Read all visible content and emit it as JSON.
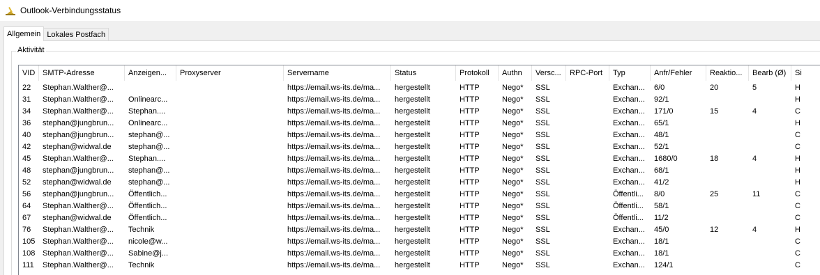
{
  "window": {
    "title": "Outlook-Verbindungsstatus"
  },
  "tabs": [
    {
      "label": "Allgemein",
      "active": true
    },
    {
      "label": "Lokales Postfach",
      "active": false
    }
  ],
  "group": {
    "label": "Aktivität"
  },
  "columns": [
    "VID",
    "SMTP-Adresse",
    "Anzeigen...",
    "Proxyserver",
    "Servername",
    "Status",
    "Protokoll",
    "Authn",
    "Versc...",
    "RPC-Port",
    "Typ",
    "Anfr/Fehler",
    "Reaktio...",
    "Bearb (Ø)",
    "Si"
  ],
  "rows": [
    [
      "22",
      "Stephan.Walther@...",
      "",
      "",
      "https://email.ws-its.de/ma...",
      "hergestellt",
      "HTTP",
      "Nego*",
      "SSL",
      "",
      "Exchan...",
      "6/0",
      "20",
      "5",
      "H"
    ],
    [
      "31",
      "Stephan.Walther@...",
      "Onlinearc...",
      "",
      "https://email.ws-its.de/ma...",
      "hergestellt",
      "HTTP",
      "Nego*",
      "SSL",
      "",
      "Exchan...",
      "92/1",
      "",
      "",
      "H"
    ],
    [
      "34",
      "Stephan.Walther@...",
      "Stephan....",
      "",
      "https://email.ws-its.de/ma...",
      "hergestellt",
      "HTTP",
      "Nego*",
      "SSL",
      "",
      "Exchan...",
      "171/0",
      "15",
      "4",
      "C"
    ],
    [
      "36",
      "stephan@jungbrun...",
      "Onlinearc...",
      "",
      "https://email.ws-its.de/ma...",
      "hergestellt",
      "HTTP",
      "Nego*",
      "SSL",
      "",
      "Exchan...",
      "65/1",
      "",
      "",
      "H"
    ],
    [
      "40",
      "stephan@jungbrun...",
      "stephan@...",
      "",
      "https://email.ws-its.de/ma...",
      "hergestellt",
      "HTTP",
      "Nego*",
      "SSL",
      "",
      "Exchan...",
      "48/1",
      "",
      "",
      "C"
    ],
    [
      "42",
      "stephan@widwal.de",
      "stephan@...",
      "",
      "https://email.ws-its.de/ma...",
      "hergestellt",
      "HTTP",
      "Nego*",
      "SSL",
      "",
      "Exchan...",
      "52/1",
      "",
      "",
      "C"
    ],
    [
      "45",
      "Stephan.Walther@...",
      "Stephan....",
      "",
      "https://email.ws-its.de/ma...",
      "hergestellt",
      "HTTP",
      "Nego*",
      "SSL",
      "",
      "Exchan...",
      "1680/0",
      "18",
      "4",
      "H"
    ],
    [
      "48",
      "stephan@jungbrun...",
      "stephan@...",
      "",
      "https://email.ws-its.de/ma...",
      "hergestellt",
      "HTTP",
      "Nego*",
      "SSL",
      "",
      "Exchan...",
      "68/1",
      "",
      "",
      "H"
    ],
    [
      "52",
      "stephan@widwal.de",
      "stephan@...",
      "",
      "https://email.ws-its.de/ma...",
      "hergestellt",
      "HTTP",
      "Nego*",
      "SSL",
      "",
      "Exchan...",
      "41/2",
      "",
      "",
      "H"
    ],
    [
      "56",
      "stephan@jungbrun...",
      "Öffentlich...",
      "",
      "https://email.ws-its.de/ma...",
      "hergestellt",
      "HTTP",
      "Nego*",
      "SSL",
      "",
      "Öffentli...",
      "8/0",
      "25",
      "11",
      "C"
    ],
    [
      "64",
      "Stephan.Walther@...",
      "Öffentlich...",
      "",
      "https://email.ws-its.de/ma...",
      "hergestellt",
      "HTTP",
      "Nego*",
      "SSL",
      "",
      "Öffentli...",
      "58/1",
      "",
      "",
      "C"
    ],
    [
      "67",
      "stephan@widwal.de",
      "Öffentlich...",
      "",
      "https://email.ws-its.de/ma...",
      "hergestellt",
      "HTTP",
      "Nego*",
      "SSL",
      "",
      "Öffentli...",
      "11/2",
      "",
      "",
      "C"
    ],
    [
      "76",
      "Stephan.Walther@...",
      "Technik",
      "",
      "https://email.ws-its.de/ma...",
      "hergestellt",
      "HTTP",
      "Nego*",
      "SSL",
      "",
      "Exchan...",
      "45/0",
      "12",
      "4",
      "H"
    ],
    [
      "105",
      "Stephan.Walther@...",
      "nicole@w...",
      "",
      "https://email.ws-its.de/ma...",
      "hergestellt",
      "HTTP",
      "Nego*",
      "SSL",
      "",
      "Exchan...",
      "18/1",
      "",
      "",
      "C"
    ],
    [
      "108",
      "Stephan.Walther@...",
      "Sabine@j...",
      "",
      "https://email.ws-its.de/ma...",
      "hergestellt",
      "HTTP",
      "Nego*",
      "SSL",
      "",
      "Exchan...",
      "18/1",
      "",
      "",
      "C"
    ],
    [
      "111",
      "Stephan.Walther@...",
      "Technik",
      "",
      "https://email.ws-its.de/ma...",
      "hergestellt",
      "HTTP",
      "Nego*",
      "SSL",
      "",
      "Exchan...",
      "124/1",
      "",
      "",
      "C"
    ]
  ]
}
